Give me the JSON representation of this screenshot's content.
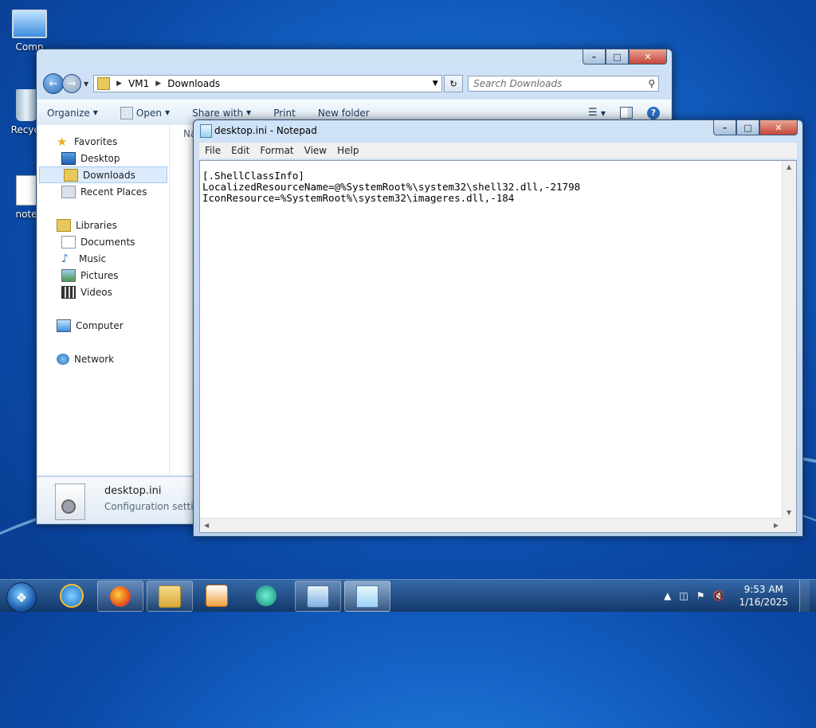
{
  "desktop": {
    "icons": [
      {
        "label": "Comp"
      },
      {
        "label": "Recycl"
      },
      {
        "label": "note"
      }
    ]
  },
  "explorer": {
    "address": [
      "VM1",
      "Downloads"
    ],
    "search_placeholder": "Search Downloads",
    "commands": {
      "organize": "Organize",
      "open": "Open",
      "share": "Share with",
      "print": "Print",
      "newfolder": "New folder"
    },
    "nav": {
      "favorites": "Favorites",
      "desktop": "Desktop",
      "downloads": "Downloads",
      "recent": "Recent Places",
      "libraries": "Libraries",
      "documents": "Documents",
      "music": "Music",
      "pictures": "Pictures",
      "videos": "Videos",
      "computer": "Computer",
      "network": "Network"
    },
    "column_header": "Na",
    "details": {
      "name": "desktop.ini",
      "type": "Configuration setting"
    }
  },
  "notepad": {
    "title": "desktop.ini - Notepad",
    "menu": [
      "File",
      "Edit",
      "Format",
      "View",
      "Help"
    ],
    "lines": [
      "[.ShellClassInfo]",
      "LocalizedResourceName=@%SystemRoot%\\system32\\shell32.dll,-21798",
      "IconResource=%SystemRoot%\\system32\\imageres.dll,-184"
    ]
  },
  "taskbar": {
    "time": "9:53 AM",
    "date": "1/16/2025"
  },
  "colors": {
    "selection": "#dcebfc",
    "close_button": "#c7453a"
  }
}
